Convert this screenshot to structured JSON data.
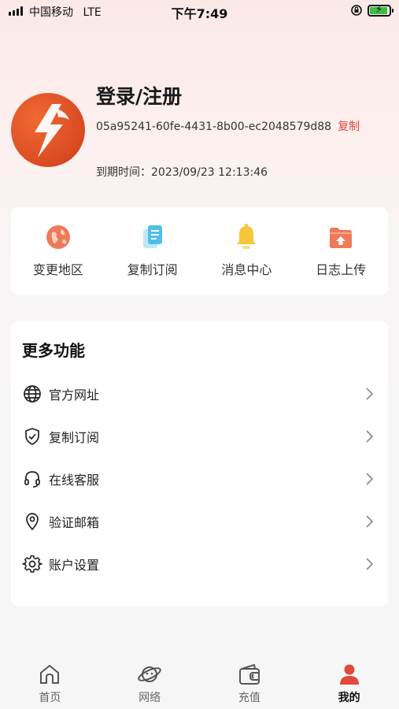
{
  "status_bar": {
    "carrier": "中国移动",
    "network": "LTE",
    "time": "下午7:49",
    "battery_level": 0.9
  },
  "profile": {
    "title": "登录/注册",
    "device_id": "05a95241-60fe-4431-8b00-ec2048579d88",
    "copy_label": "复制",
    "expiry_label": "到期时间：",
    "expiry_value": "2023/09/23 12:13:46"
  },
  "quick_actions": [
    {
      "label": "变更地区",
      "icon": "globe-icon",
      "color": "#ee7a5a"
    },
    {
      "label": "复制订阅",
      "icon": "copy-doc-icon",
      "color": "#4dbfe8"
    },
    {
      "label": "消息中心",
      "icon": "bell-icon",
      "color": "#f5c53a"
    },
    {
      "label": "日志上传",
      "icon": "folder-upload-icon",
      "color": "#ee7a5a"
    }
  ],
  "more": {
    "title": "更多功能",
    "items": [
      {
        "label": "官方网址",
        "icon": "globe-outline-icon"
      },
      {
        "label": "复制订阅",
        "icon": "shield-check-icon"
      },
      {
        "label": "在线客服",
        "icon": "headset-icon"
      },
      {
        "label": "验证邮箱",
        "icon": "location-pin-icon"
      },
      {
        "label": "账户设置",
        "icon": "gear-icon"
      }
    ]
  },
  "tabs": [
    {
      "label": "首页",
      "icon": "home-icon"
    },
    {
      "label": "网络",
      "icon": "planet-icon"
    },
    {
      "label": "充值",
      "icon": "wallet-icon"
    },
    {
      "label": "我的",
      "icon": "user-icon",
      "active": true
    }
  ],
  "colors": {
    "accent": "#e2483c",
    "brand_orange": "#d94a22"
  }
}
